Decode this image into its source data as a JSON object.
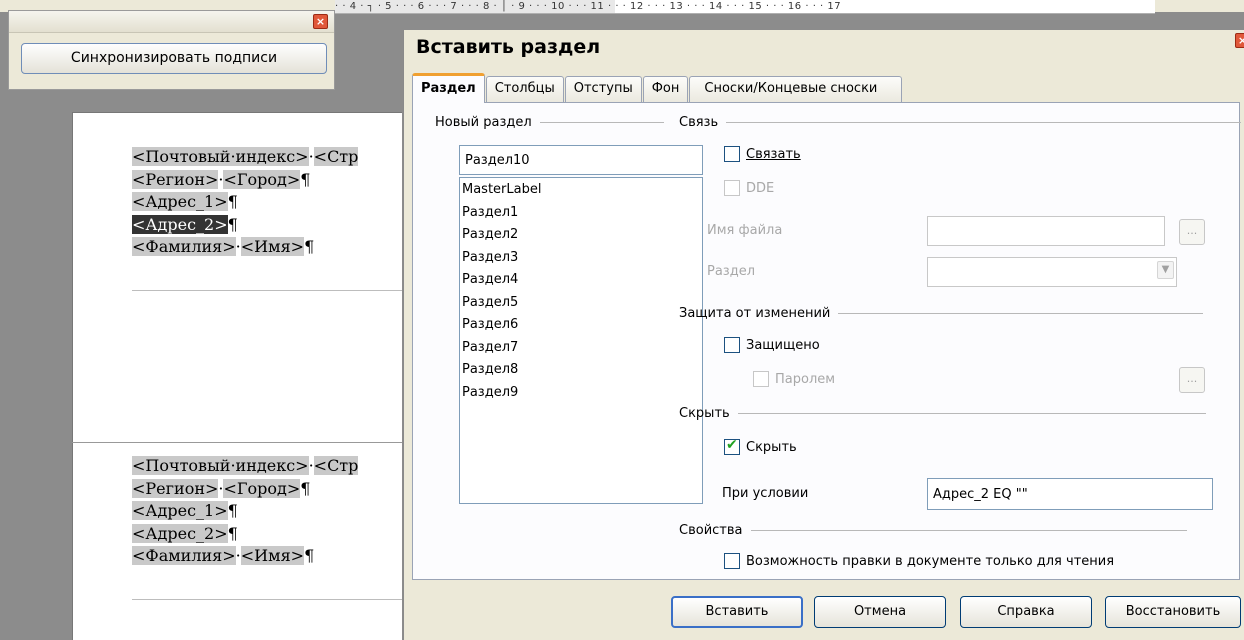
{
  "ruler": {
    "text": "· · 4 · ┐ · 5 · · · 6 · · · 7 · · · 8 · │ · 9 · · · 10 · · · 11 · · · 12 · · · 13 · · · 14 · · · 15 · · · 16 · · · 17"
  },
  "sync_panel": {
    "button_label": "Синхронизировать подписи"
  },
  "document": {
    "label1": [
      [
        "<Почтовый·индекс>",
        "·",
        "<Стр"
      ],
      [
        "<Регион>",
        "·",
        "<Город>",
        "¶"
      ],
      [
        "<Адрес_1>",
        "¶"
      ],
      [
        "<Адрес_2>",
        "¶"
      ],
      [
        "<Фамилия>",
        "·",
        "<Имя>",
        "¶"
      ]
    ],
    "label2": [
      [
        "<Почтовый·индекс>",
        "·",
        "<Стр"
      ],
      [
        "<Регион>",
        "·",
        "<Город>",
        "¶"
      ],
      [
        "<Адрес_1>",
        "¶"
      ],
      [
        "<Адрес_2>",
        "¶"
      ],
      [
        "<Фамилия>",
        "·",
        "<Имя>",
        "¶"
      ]
    ]
  },
  "dialog": {
    "title": "Вставить раздел",
    "tabs": [
      "Раздел",
      "Столбцы",
      "Отступы",
      "Фон",
      "Сноски/Концевые сноски"
    ],
    "new_section": {
      "heading": "Новый раздел",
      "name_value": "Раздел10",
      "list_items": [
        "MasterLabel",
        "Раздел1",
        "Раздел2",
        "Раздел3",
        "Раздел4",
        "Раздел5",
        "Раздел6",
        "Раздел7",
        "Раздел8",
        "Раздел9"
      ]
    },
    "link": {
      "heading": "Связь",
      "link_label": "Связать",
      "link_checked": false,
      "dde_label": "DDE",
      "filename_label": "Имя файла",
      "browse_label": "...",
      "section_label": "Раздел",
      "section_value": ""
    },
    "protection": {
      "heading": "Защита от изменений",
      "protected_label": "Защищено",
      "protected_checked": false,
      "password_label": "Паролем",
      "password_btn": "..."
    },
    "hide": {
      "heading": "Скрыть",
      "hide_label": "Скрыть",
      "hide_checked": true,
      "condition_label": "При условии",
      "condition_value": "Адрес_2 EQ \"\""
    },
    "properties": {
      "heading": "Свойства",
      "readonly_label": "Возможность правки в документе только для чтения",
      "readonly_checked": false
    },
    "buttons": {
      "insert": "Вставить",
      "cancel": "Отмена",
      "help": "Справка",
      "reset": "Восстановить"
    }
  }
}
